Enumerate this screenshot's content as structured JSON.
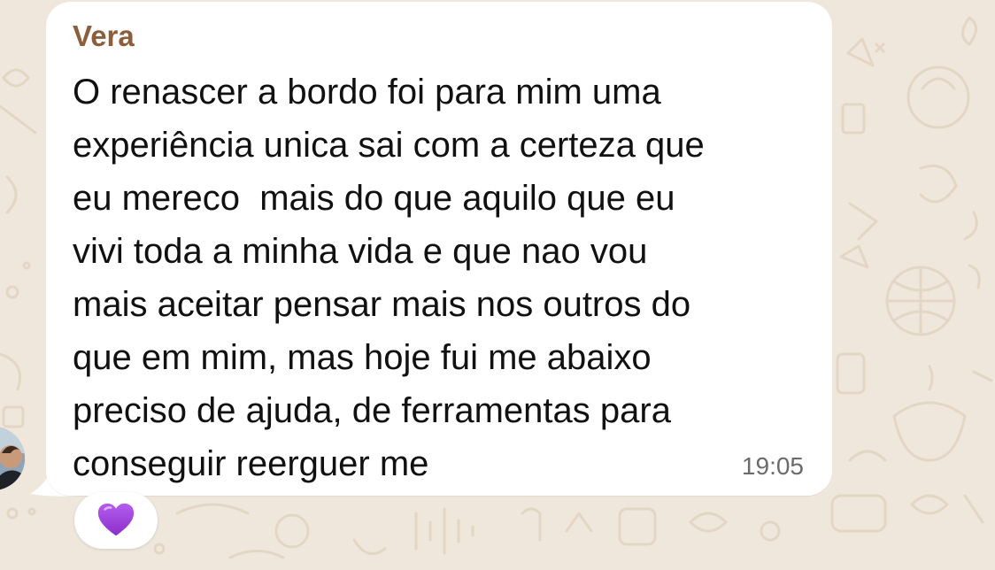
{
  "chat": {
    "sender": "Vera",
    "message_lines": [
      "O renascer a bordo foi para mim uma",
      "experiência unica sai com a certeza que",
      "eu mereco  mais do que aquilo que eu",
      "vivi toda a minha vida e que nao vou",
      "mais aceitar pensar mais nos outros do",
      "que em mim, mas hoje fui me abaixo",
      "preciso de ajuda, de ferramentas para",
      "conseguir reerguer me"
    ],
    "timestamp": "19:05",
    "reaction": {
      "emoji": "💜",
      "icon": "purple-heart-icon",
      "color": "#9b3ad6"
    }
  },
  "theme": {
    "wallpaper_color": "#efe7dc",
    "doodle_color": "#e3d6c4",
    "bubble_color": "#ffffff",
    "sender_color": "#8d5e3b",
    "text_color": "#111111",
    "timestamp_color": "#6b6b6b"
  }
}
